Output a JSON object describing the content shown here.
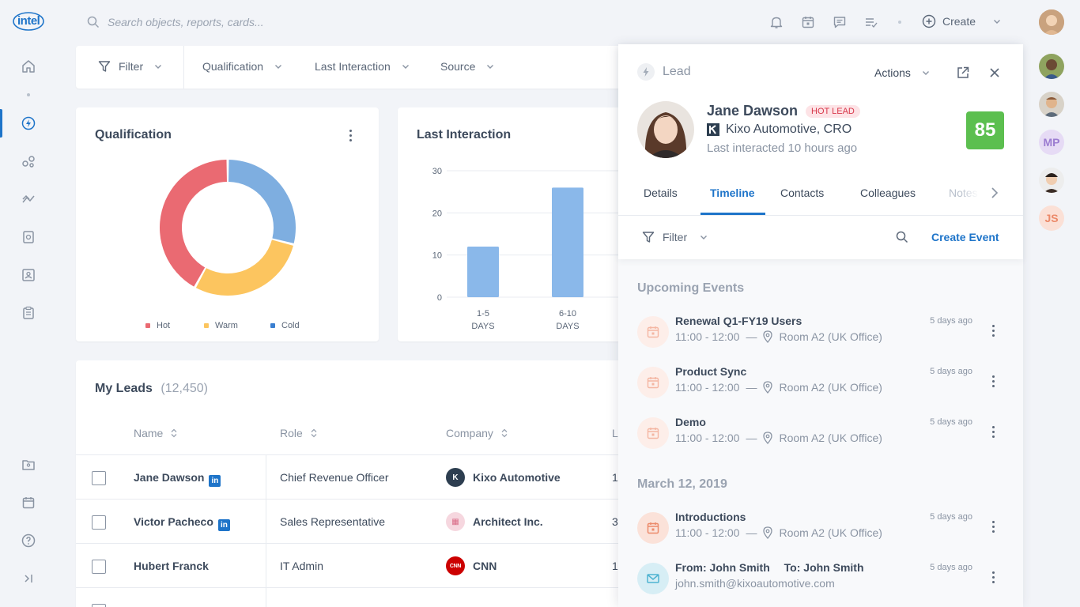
{
  "brand": {
    "logo_text": "intel"
  },
  "search": {
    "placeholder": "Search objects, reports, cards..."
  },
  "topbar": {
    "create_label": "Create"
  },
  "filters": {
    "filter_label": "Filter",
    "items": [
      "Qualification",
      "Last Interaction",
      "Source"
    ]
  },
  "qualification_card": {
    "title": "Qualification",
    "legend": [
      {
        "label": "Hot",
        "color": "#ea6a72"
      },
      {
        "label": "Warm",
        "color": "#fcc55f"
      },
      {
        "label": "Cold",
        "color": "#7eaee0"
      }
    ]
  },
  "chart_data": [
    {
      "type": "pie",
      "title": "Qualification",
      "categories": [
        "Cold",
        "Warm",
        "Hot"
      ],
      "values": [
        29,
        29,
        42
      ],
      "colors": [
        "#7eaee0",
        "#fcc55f",
        "#ea6a72"
      ],
      "legend": "bottom"
    },
    {
      "type": "bar",
      "title": "Last Interaction",
      "categories": [
        "1-5 DAYS",
        "6-10 DAYS"
      ],
      "values": [
        12,
        26
      ],
      "ylim": [
        0,
        30
      ],
      "yticks": [
        0,
        10,
        20,
        30
      ],
      "grid": true,
      "color": "#8ab8ea"
    }
  ],
  "interaction_card": {
    "title": "Last Interaction",
    "yticks": [
      "30",
      "20",
      "10",
      "0"
    ],
    "xlabels": [
      {
        "top": "1-5",
        "bottom": "DAYS"
      },
      {
        "top": "6-10",
        "bottom": "DAYS"
      }
    ]
  },
  "leads": {
    "title": "My Leads",
    "count": "(12,450)",
    "columns": [
      "Name",
      "Role",
      "Company",
      "L"
    ],
    "rows": [
      {
        "name": "Jane Dawson",
        "linkedin": true,
        "role": "Chief Revenue Officer",
        "company": "Kixo Automotive",
        "logo_text": "K",
        "logo_color": "#2d3e50",
        "last": "1"
      },
      {
        "name": "Victor Pacheco",
        "linkedin": true,
        "role": "Sales Representative",
        "company": "Architect Inc.",
        "logo_text": "▦",
        "logo_color": "#f6d7df",
        "last": "3"
      },
      {
        "name": "Hubert Franck",
        "linkedin": false,
        "role": "IT Admin",
        "company": "CNN",
        "logo_text": "CNN",
        "logo_color": "#cc0000",
        "last": "1"
      }
    ]
  },
  "lead_panel": {
    "type_label": "Lead",
    "actions_label": "Actions",
    "name": "Jane Dawson",
    "badge": "HOT LEAD",
    "company_role": "Kixo Automotive, CRO",
    "last_interacted": "Last interacted 10 hours ago",
    "score": "85",
    "tabs": [
      "Details",
      "Timeline",
      "Contacts",
      "Colleagues",
      "Notes"
    ],
    "active_tab": "Timeline",
    "filter_label": "Filter",
    "create_event_label": "Create Event",
    "upcoming_header": "Upcoming Events",
    "upcoming": [
      {
        "title": "Renewal Q1-FY19 Users",
        "time": "11:00 - 12:00",
        "location": "Room A2 (UK Office)",
        "ago": "5 days ago"
      },
      {
        "title": "Product Sync",
        "time": "11:00 - 12:00",
        "location": "Room A2 (UK Office)",
        "ago": "5 days ago"
      },
      {
        "title": "Demo",
        "time": "11:00 - 12:00",
        "location": "Room A2 (UK Office)",
        "ago": "5 days ago"
      }
    ],
    "date_header": "March 12, 2019",
    "past": [
      {
        "title": "Introductions",
        "time": "11:00 - 12:00",
        "location": "Room A2 (UK Office)",
        "ago": "5 days ago"
      }
    ],
    "email": {
      "from": "From: John Smith",
      "to": "To: John Smith",
      "address": "john.smith@kixoautomotive.com",
      "ago": "5 days ago"
    }
  },
  "collaborators": [
    {
      "initials": "",
      "color": "#c9a27e"
    },
    {
      "initials": "",
      "color": "#6b4a34"
    },
    {
      "initials": "",
      "color": "#b7845e"
    },
    {
      "initials": "MP",
      "color": "#e6dbf5",
      "text_color": "#9b7cd1"
    },
    {
      "initials": "",
      "color": "#3b2d26"
    },
    {
      "initials": "JS",
      "color": "#fbe0d6",
      "text_color": "#ec8a6a"
    }
  ],
  "colors": {
    "accent": "#1e74c9",
    "score": "#5cbf4f",
    "hot_badge_bg": "#fde3e6",
    "hot_badge_text": "#d8384b"
  }
}
